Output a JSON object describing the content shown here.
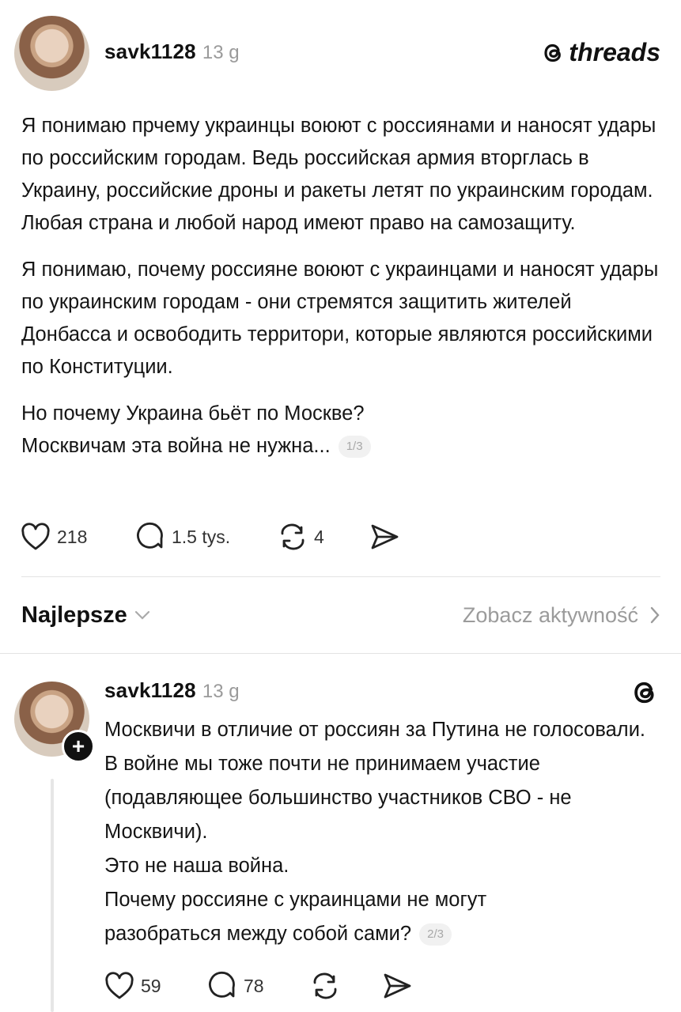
{
  "post": {
    "username": "savk1128",
    "time": "13 g",
    "brand": "threads",
    "paragraphs": [
      "Я понимаю прчему украинцы воюют с россиянами и наносят удары по российским городам. Ведь российская армия вторглась в Украину, российские дроны и ракеты летят по украинским городам. Любая страна и любой народ имеют право на самозащиту.",
      "Я понимаю, почему россияне воюют с украинцами и наносят удары по украинским городам - они стремятся защитить жителей Донбасса и освободить территори, которые являются российскими по Конституции.",
      "Но почему Украина бьёт по Москве? Москвичам эта война не нужна..."
    ],
    "pager": "1/3",
    "likes": "218",
    "comments": "1.5 tys.",
    "reposts": "4"
  },
  "sort": {
    "label": "Najlepsze",
    "activity_link": "Zobacz aktywność"
  },
  "reply": {
    "username": "savk1128",
    "time": "13 g",
    "lines": [
      "Москвичи в отличие от россиян за Путина не голосовали. В войне мы тоже почти не принимаем участие (подавляющее большинство участников СВО - не Москвичи).",
      "Это не наша война.",
      "Почему россияне с украинцами не могут разобраться между собой сами?"
    ],
    "pager": "2/3",
    "likes": "59",
    "comments": "78",
    "plus_icon": "+"
  },
  "icons": {
    "threads_logo": "threads-logo-icon",
    "heart": "heart-icon",
    "comment": "comment-bubble-icon",
    "repost": "repost-icon",
    "share": "send-icon",
    "chevron_down": "chevron-down-icon",
    "chevron_right": "chevron-right-icon",
    "plus": "plus-icon"
  }
}
